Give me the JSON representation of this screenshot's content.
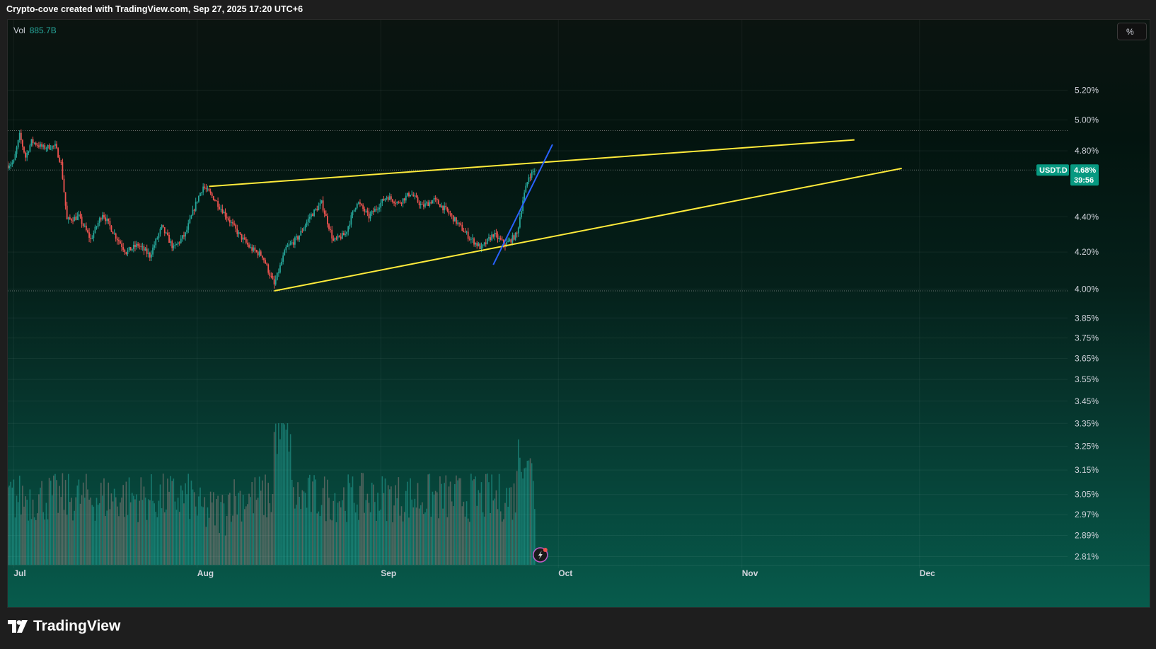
{
  "header": {
    "attribution": "Crypto-cove created with TradingView.com, Sep 27, 2025 17:20 UTC+6"
  },
  "legend": {
    "vol_label": "Vol",
    "vol_value": "885.7B"
  },
  "controls": {
    "percent_button": "%"
  },
  "footer": {
    "brand": "TradingView"
  },
  "colors": {
    "bull": "#26a69a",
    "bear": "#ef5350",
    "trendline": "#ffeb3b",
    "blue_line": "#2962ff",
    "tag_bg": "#089981"
  },
  "chart_data": {
    "type": "candlestick",
    "symbol": "USDT.D",
    "timeframe_note": "intraday candles, Jul - Sep 2025",
    "y_scale": "log",
    "ylim": [
      2.78,
      5.6
    ],
    "xlim": [
      "2025-06-30",
      "2025-12-26"
    ],
    "y_ticks": [
      "5.20%",
      "5.00%",
      "4.80%",
      "4.40%",
      "4.20%",
      "4.00%",
      "3.85%",
      "3.75%",
      "3.65%",
      "3.55%",
      "3.45%",
      "3.35%",
      "3.25%",
      "3.15%",
      "3.05%",
      "2.97%",
      "2.89%",
      "2.81%"
    ],
    "x_ticks": [
      {
        "label": "Jul",
        "date": "2025-07-01"
      },
      {
        "label": "Aug",
        "date": "2025-08-01"
      },
      {
        "label": "Sep",
        "date": "2025-09-01"
      },
      {
        "label": "Oct",
        "date": "2025-10-01"
      },
      {
        "label": "Nov",
        "date": "2025-11-01"
      },
      {
        "label": "Dec",
        "date": "2025-12-01"
      }
    ],
    "close_path": [
      [
        "2025-06-30",
        4.71
      ],
      [
        "2025-07-01",
        4.73
      ],
      [
        "2025-07-02",
        4.9
      ],
      [
        "2025-07-03",
        4.76
      ],
      [
        "2025-07-04",
        4.86
      ],
      [
        "2025-07-06",
        4.82
      ],
      [
        "2025-07-08",
        4.83
      ],
      [
        "2025-07-09",
        4.72
      ],
      [
        "2025-07-10",
        4.38
      ],
      [
        "2025-07-12",
        4.4
      ],
      [
        "2025-07-14",
        4.27
      ],
      [
        "2025-07-16",
        4.42
      ],
      [
        "2025-07-18",
        4.3
      ],
      [
        "2025-07-20",
        4.2
      ],
      [
        "2025-07-22",
        4.24
      ],
      [
        "2025-07-24",
        4.18
      ],
      [
        "2025-07-26",
        4.34
      ],
      [
        "2025-07-28",
        4.22
      ],
      [
        "2025-07-30",
        4.3
      ],
      [
        "2025-08-01",
        4.5
      ],
      [
        "2025-08-02",
        4.58
      ],
      [
        "2025-08-04",
        4.5
      ],
      [
        "2025-08-06",
        4.4
      ],
      [
        "2025-08-08",
        4.3
      ],
      [
        "2025-08-10",
        4.22
      ],
      [
        "2025-08-12",
        4.18
      ],
      [
        "2025-08-14",
        4.02
      ],
      [
        "2025-08-16",
        4.22
      ],
      [
        "2025-08-18",
        4.28
      ],
      [
        "2025-08-20",
        4.4
      ],
      [
        "2025-08-22",
        4.48
      ],
      [
        "2025-08-24",
        4.26
      ],
      [
        "2025-08-26",
        4.3
      ],
      [
        "2025-08-28",
        4.49
      ],
      [
        "2025-08-30",
        4.4
      ],
      [
        "2025-09-02",
        4.52
      ],
      [
        "2025-09-04",
        4.48
      ],
      [
        "2025-09-06",
        4.54
      ],
      [
        "2025-09-08",
        4.46
      ],
      [
        "2025-09-10",
        4.5
      ],
      [
        "2025-09-12",
        4.44
      ],
      [
        "2025-09-14",
        4.36
      ],
      [
        "2025-09-16",
        4.28
      ],
      [
        "2025-09-18",
        4.22
      ],
      [
        "2025-09-20",
        4.3
      ],
      [
        "2025-09-22",
        4.24
      ],
      [
        "2025-09-24",
        4.3
      ],
      [
        "2025-09-25",
        4.5
      ],
      [
        "2025-09-26",
        4.64
      ],
      [
        "2025-09-27",
        4.68
      ]
    ],
    "volume_bars": "green/gray volume histogram beneath price, peaks near 2025-08-15 and 2025-09-25",
    "horizontal_levels": [
      4.93,
      4.68,
      3.99
    ],
    "trendlines": [
      {
        "color": "yellow",
        "from": [
          "2025-08-03",
          4.58
        ],
        "to": [
          "2025-11-20",
          4.87
        ]
      },
      {
        "color": "yellow",
        "from": [
          "2025-08-14",
          3.99
        ],
        "to": [
          "2025-11-28",
          4.69
        ]
      },
      {
        "color": "blue",
        "from": [
          "2025-09-20",
          4.13
        ],
        "to": [
          "2025-09-30",
          4.84
        ]
      }
    ],
    "last_price_tag": {
      "symbol": "USDT.D",
      "value": "4.68%",
      "countdown": "39:56"
    }
  }
}
